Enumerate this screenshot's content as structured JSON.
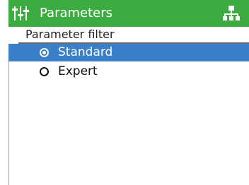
{
  "header": {
    "title": "Parameters",
    "left_icon": "sliders-icon",
    "right_icon": "network-tree-icon",
    "background": "#3dac40"
  },
  "filter": {
    "label": "Parameter filter"
  },
  "options": [
    {
      "label": "Standard",
      "selected": true
    },
    {
      "label": "Expert",
      "selected": false
    }
  ],
  "colors": {
    "selection": "#3a80c8",
    "accent_dash": "#3a7fc4"
  }
}
